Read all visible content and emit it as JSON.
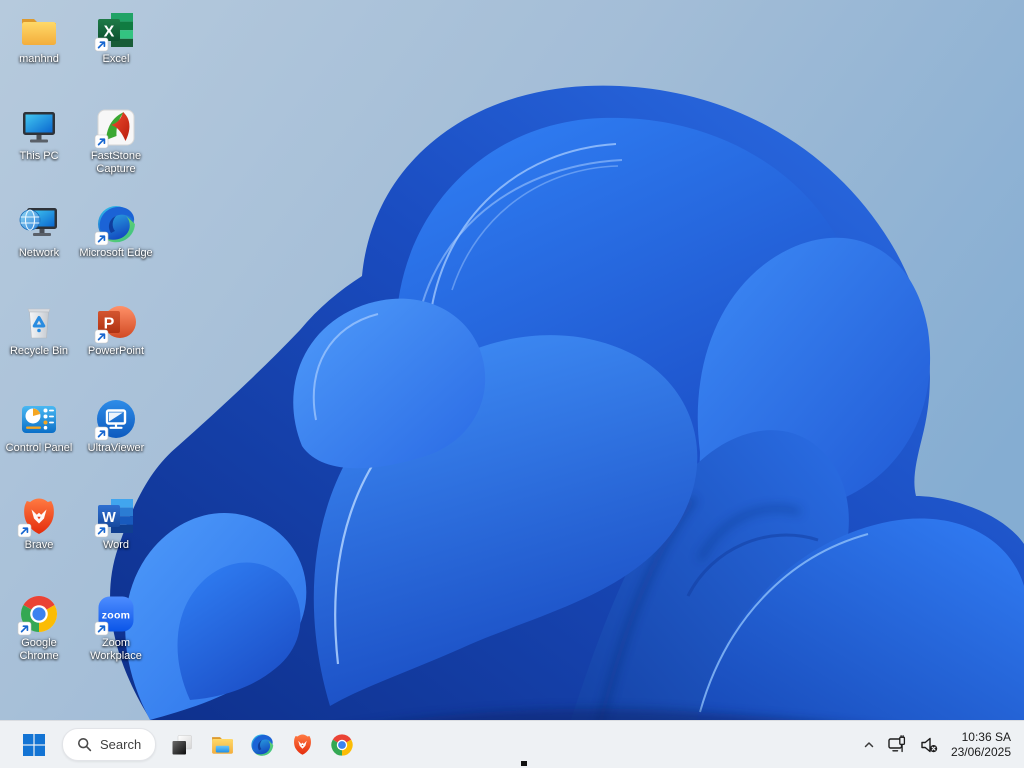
{
  "wallpaper": {
    "name": "windows-11-bloom",
    "bg_left": "#b3c8dd",
    "bg_right": "#86aed2",
    "bloom_dark": "#0d2d86",
    "bloom_primary": "#2267e0",
    "bloom_bright": "#4190f8",
    "bloom_highlight": "#a7ccff"
  },
  "desktop": {
    "icons": [
      {
        "label": "manhnd",
        "icon": "folder-icon",
        "shortcut": false
      },
      {
        "label": "Excel",
        "icon": "excel-icon",
        "shortcut": true
      },
      {
        "label": "This PC",
        "icon": "this-pc-icon",
        "shortcut": false
      },
      {
        "label": "FastStone Capture",
        "icon": "faststone-capture-icon",
        "shortcut": true
      },
      {
        "label": "Network",
        "icon": "network-icon",
        "shortcut": false
      },
      {
        "label": "Microsoft Edge",
        "icon": "edge-icon",
        "shortcut": true
      },
      {
        "label": "Recycle Bin",
        "icon": "recycle-bin-icon",
        "shortcut": false
      },
      {
        "label": "PowerPoint",
        "icon": "powerpoint-icon",
        "shortcut": true
      },
      {
        "label": "Control Panel",
        "icon": "control-panel-icon",
        "shortcut": false
      },
      {
        "label": "UltraViewer",
        "icon": "ultraviewer-icon",
        "shortcut": true
      },
      {
        "label": "Brave",
        "icon": "brave-icon",
        "shortcut": true
      },
      {
        "label": "Word",
        "icon": "word-icon",
        "shortcut": true
      },
      {
        "label": "Google Chrome",
        "icon": "chrome-icon",
        "shortcut": true
      },
      {
        "label": "Zoom Workplace",
        "icon": "zoom-icon",
        "shortcut": true
      }
    ]
  },
  "taskbar": {
    "start": {
      "icon": "windows-logo-icon"
    },
    "search": {
      "label": "Search",
      "icon": "search-icon"
    },
    "pinned_apps": [
      {
        "name": "app-window",
        "icon": "overlapping-squares-icon"
      },
      {
        "name": "file-explorer",
        "icon": "folder-icon"
      },
      {
        "name": "microsoft-edge",
        "icon": "edge-icon"
      },
      {
        "name": "brave",
        "icon": "brave-icon"
      },
      {
        "name": "google-chrome",
        "icon": "chrome-icon"
      }
    ],
    "tray": {
      "chevron_icon": "chevron-up-icon",
      "network_icon": "wired-network-icon",
      "volume_icon": "volume-muted-icon",
      "time": "10:36 SA",
      "date": "23/06/2025"
    }
  }
}
